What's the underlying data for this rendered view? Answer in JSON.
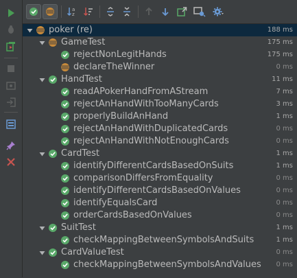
{
  "colors": {
    "background": "#3c3f41",
    "selected_row": "#0d293e",
    "pass_green": "#59a869",
    "ignored_orange": "#c88a3a",
    "run_green": "#499c54",
    "stop_red": "#c75450",
    "text": "#bbbbbb",
    "time_text": "#8a8a8a"
  },
  "left_toolbar": {
    "items": [
      {
        "icon": "run-icon"
      },
      {
        "icon": "debug-icon"
      },
      {
        "icon": "rerun-failed-icon"
      },
      {
        "icon": "stop-icon"
      },
      {
        "icon": "dump-threads-icon"
      },
      {
        "icon": "exit-icon"
      },
      {
        "icon": "layout-icon"
      },
      {
        "icon": "pin-icon"
      },
      {
        "icon": "close-icon"
      }
    ]
  },
  "top_toolbar": {
    "items": [
      {
        "icon": "show-passed-icon",
        "toggled": true
      },
      {
        "icon": "show-ignored-icon",
        "toggled": true
      },
      {
        "icon": "sort-alphabetically-icon"
      },
      {
        "icon": "sort-by-duration-icon"
      },
      {
        "icon": "expand-all-icon"
      },
      {
        "icon": "collapse-all-icon"
      },
      {
        "icon": "previous-failed-icon"
      },
      {
        "icon": "next-failed-icon"
      },
      {
        "icon": "export-results-icon"
      },
      {
        "icon": "import-tests-icon"
      },
      {
        "icon": "settings-icon"
      }
    ]
  },
  "tree": {
    "rows": [
      {
        "level": 0,
        "label": "poker (re)",
        "time": "188 ms",
        "status": "ignored",
        "expandable": true,
        "selected": true
      },
      {
        "level": 1,
        "label": "GameTest",
        "time": "175 ms",
        "status": "ignored",
        "expandable": true
      },
      {
        "level": 2,
        "label": "rejectNonLegitHands",
        "time": "175 ms",
        "status": "passed"
      },
      {
        "level": 2,
        "label": "declareTheWinner",
        "time": "0 ms",
        "status": "ignored"
      },
      {
        "level": 1,
        "label": "HandTest",
        "time": "11 ms",
        "status": "passed",
        "expandable": true
      },
      {
        "level": 2,
        "label": "readAPokerHandFromAStream",
        "time": "7 ms",
        "status": "passed"
      },
      {
        "level": 2,
        "label": "rejectAnHandWithTooManyCards",
        "time": "3 ms",
        "status": "passed"
      },
      {
        "level": 2,
        "label": "properlyBuildAnHand",
        "time": "1 ms",
        "status": "passed"
      },
      {
        "level": 2,
        "label": "rejectAnHandWithDuplicatedCards",
        "time": "0 ms",
        "status": "passed"
      },
      {
        "level": 2,
        "label": "rejectAnHandWithNotEnoughCards",
        "time": "0 ms",
        "status": "passed"
      },
      {
        "level": 1,
        "label": "CardTest",
        "time": "1 ms",
        "status": "passed",
        "expandable": true
      },
      {
        "level": 2,
        "label": "identifyDifferentCardsBasedOnSuits",
        "time": "1 ms",
        "status": "passed"
      },
      {
        "level": 2,
        "label": "comparisonDiffersFromEquality",
        "time": "0 ms",
        "status": "passed"
      },
      {
        "level": 2,
        "label": "identifyDifferentCardsBasedOnValues",
        "time": "0 ms",
        "status": "passed"
      },
      {
        "level": 2,
        "label": "identifyEqualsCard",
        "time": "0 ms",
        "status": "passed"
      },
      {
        "level": 2,
        "label": "orderCardsBasedOnValues",
        "time": "0 ms",
        "status": "passed"
      },
      {
        "level": 1,
        "label": "SuitTest",
        "time": "1 ms",
        "status": "passed",
        "expandable": true
      },
      {
        "level": 2,
        "label": "checkMappingBetweenSymbolsAndSuits",
        "time": "1 ms",
        "status": "passed"
      },
      {
        "level": 1,
        "label": "CardValueTest",
        "time": "0 ms",
        "status": "passed",
        "expandable": true
      },
      {
        "level": 2,
        "label": "checkMappingBetweenSymbolsAndValues",
        "time": "0 ms",
        "status": "passed"
      }
    ]
  }
}
